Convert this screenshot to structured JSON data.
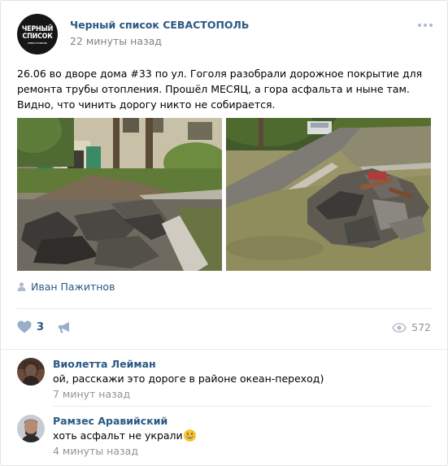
{
  "group": {
    "name": "Черный список СЕВАСТОПОЛЬ",
    "logo_line1": "ЧЕРНЫЙ",
    "logo_line2": "СПИСОК",
    "logo_line3": "СЕВАСТОПОЛЬ"
  },
  "post": {
    "time": "22 минуты назад",
    "text": "26.06 во дворе дома #33 по ул. Гоголя разобрали дорожное покрытие для ремонта трубы отопления. Прошёл МЕСЯЦ, а гора асфальта и ныне там. Видно, что чинить дорогу никто не собирается.",
    "author": "Иван Пажитнов"
  },
  "stats": {
    "likes": "3",
    "views": "572"
  },
  "comments": [
    {
      "author": "Виолетта Лейман",
      "text": "ой, расскажи это дороге в районе океан-переход)",
      "time": "7 минут назад"
    },
    {
      "author": "Рамзес Аравийский",
      "text": "хоть асфальт не украли",
      "time": "4 минуты назад",
      "emoji": "grinning-emoji"
    }
  ],
  "icons": {
    "more": "more-dots-icon",
    "author": "person-icon",
    "like": "heart-icon",
    "share": "megaphone-icon",
    "views": "eye-icon"
  },
  "colors": {
    "link": "#2a5885",
    "meta": "#828282",
    "icon": "#aebbcc"
  }
}
